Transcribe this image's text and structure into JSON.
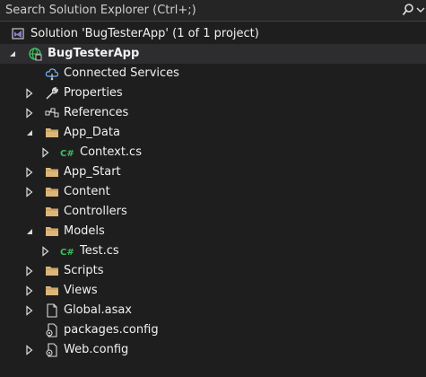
{
  "search": {
    "placeholder": "Search Solution Explorer (Ctrl+;)"
  },
  "colors": {
    "background": "#1e1e1e",
    "folder": "#dcb67a",
    "csharp": "#3fbf5e",
    "solution_icon": "#8a7dd6"
  },
  "tree": {
    "solution": {
      "label": "Solution 'BugTesterApp' (1 of 1 project)",
      "icon": "solution-icon"
    },
    "project": {
      "label": "BugTesterApp",
      "icon": "web-project-icon",
      "expanded": true
    },
    "items": [
      {
        "label": "Connected Services",
        "icon": "connected-services-icon",
        "expandable": false
      },
      {
        "label": "Properties",
        "icon": "wrench-icon",
        "expandable": true,
        "expanded": false
      },
      {
        "label": "References",
        "icon": "references-icon",
        "expandable": true,
        "expanded": false
      },
      {
        "label": "App_Data",
        "icon": "folder-icon",
        "expandable": true,
        "expanded": true
      },
      {
        "label": "Context.cs",
        "icon": "csharp-file-icon",
        "expandable": true,
        "expanded": false
      },
      {
        "label": "App_Start",
        "icon": "folder-icon",
        "expandable": true,
        "expanded": false
      },
      {
        "label": "Content",
        "icon": "folder-icon",
        "expandable": true,
        "expanded": false
      },
      {
        "label": "Controllers",
        "icon": "folder-icon",
        "expandable": false
      },
      {
        "label": "Models",
        "icon": "folder-icon",
        "expandable": true,
        "expanded": true
      },
      {
        "label": "Test.cs",
        "icon": "csharp-file-icon",
        "expandable": true,
        "expanded": false
      },
      {
        "label": "Scripts",
        "icon": "folder-icon",
        "expandable": true,
        "expanded": false
      },
      {
        "label": "Views",
        "icon": "folder-icon",
        "expandable": true,
        "expanded": false
      },
      {
        "label": "Global.asax",
        "icon": "global-asax-icon",
        "expandable": true,
        "expanded": false
      },
      {
        "label": "packages.config",
        "icon": "config-file-icon",
        "expandable": false
      },
      {
        "label": "Web.config",
        "icon": "config-file-icon",
        "expandable": true,
        "expanded": false
      }
    ]
  }
}
